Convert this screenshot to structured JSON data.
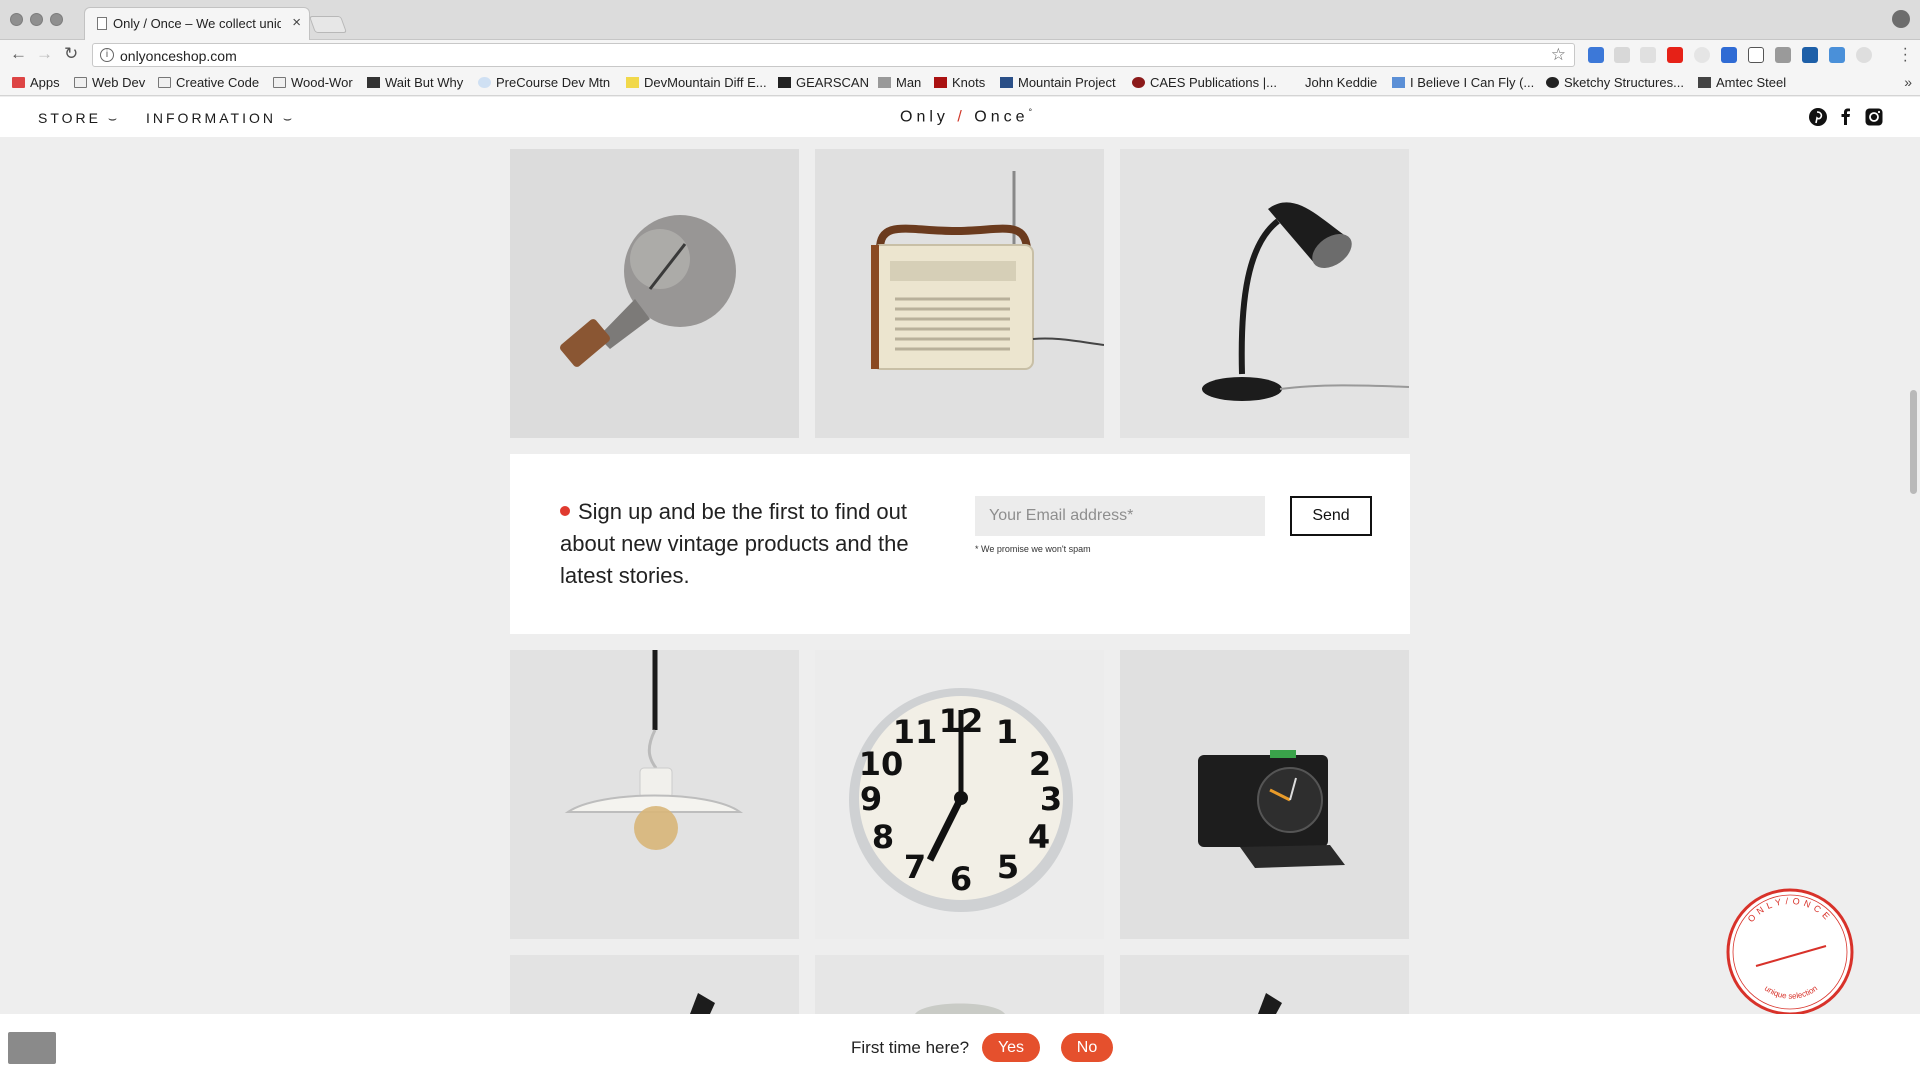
{
  "browser": {
    "tab_title": "Only / Once – We collect unique",
    "tab_close": "×",
    "url": "onlyonceshop.com",
    "info_icon": "i",
    "star_icon": "☆",
    "bookmarks": [
      {
        "label": "Apps",
        "icon": "apps-grid-icon"
      },
      {
        "label": "Web Dev",
        "icon": "folder-icon"
      },
      {
        "label": "Creative Code",
        "icon": "folder-icon"
      },
      {
        "label": "Wood-Wor",
        "icon": "folder-icon"
      },
      {
        "label": "Wait But Why",
        "icon": "site-icon"
      },
      {
        "label": "PreCourse Dev Mtn",
        "icon": "site-icon"
      },
      {
        "label": "DevMountain Diff E...",
        "icon": "site-icon"
      },
      {
        "label": "GEARSCAN",
        "icon": "site-icon"
      },
      {
        "label": "Man",
        "icon": "site-icon"
      },
      {
        "label": "Knots",
        "icon": "site-icon"
      },
      {
        "label": "Mountain Project",
        "icon": "site-icon"
      },
      {
        "label": "CAES Publications |...",
        "icon": "site-icon"
      },
      {
        "label": "John Keddie",
        "icon": "none"
      },
      {
        "label": "I Believe I Can Fly (...",
        "icon": "site-icon"
      },
      {
        "label": "Sketchy Structures...",
        "icon": "site-icon"
      },
      {
        "label": "Amtec Steel",
        "icon": "site-icon"
      }
    ],
    "bookmarks_more": "»"
  },
  "site": {
    "nav_store": "STORE ⌣",
    "nav_information": "INFORMATION ⌣",
    "logo_left": "Only",
    "logo_slash": "/",
    "logo_right": "Once",
    "logo_mark": "°",
    "social": [
      "pinterest-icon",
      "facebook-icon",
      "instagram-icon"
    ]
  },
  "products_row1": [
    "light-bulb",
    "radio",
    "desk-lamp"
  ],
  "products_row2": [
    "pendant-lamp",
    "wall-clock",
    "alarm-clock"
  ],
  "signup": {
    "text": "Sign up and be the first to find out about new vintage products and the latest stories.",
    "email_placeholder": "Your Email address*",
    "email_value": "",
    "send_label": "Send",
    "spam_note": "* We promise we won't spam"
  },
  "first_time": {
    "label": "First time here?",
    "yes_label": "Yes",
    "no_label": "No"
  },
  "stamp": {
    "top_text": "ONLY/ONCE",
    "bottom_text": "unique selection"
  },
  "colors": {
    "accent_red": "#e03a2f",
    "pill_orange": "#e5502d",
    "page_bg": "#eeeeee"
  }
}
